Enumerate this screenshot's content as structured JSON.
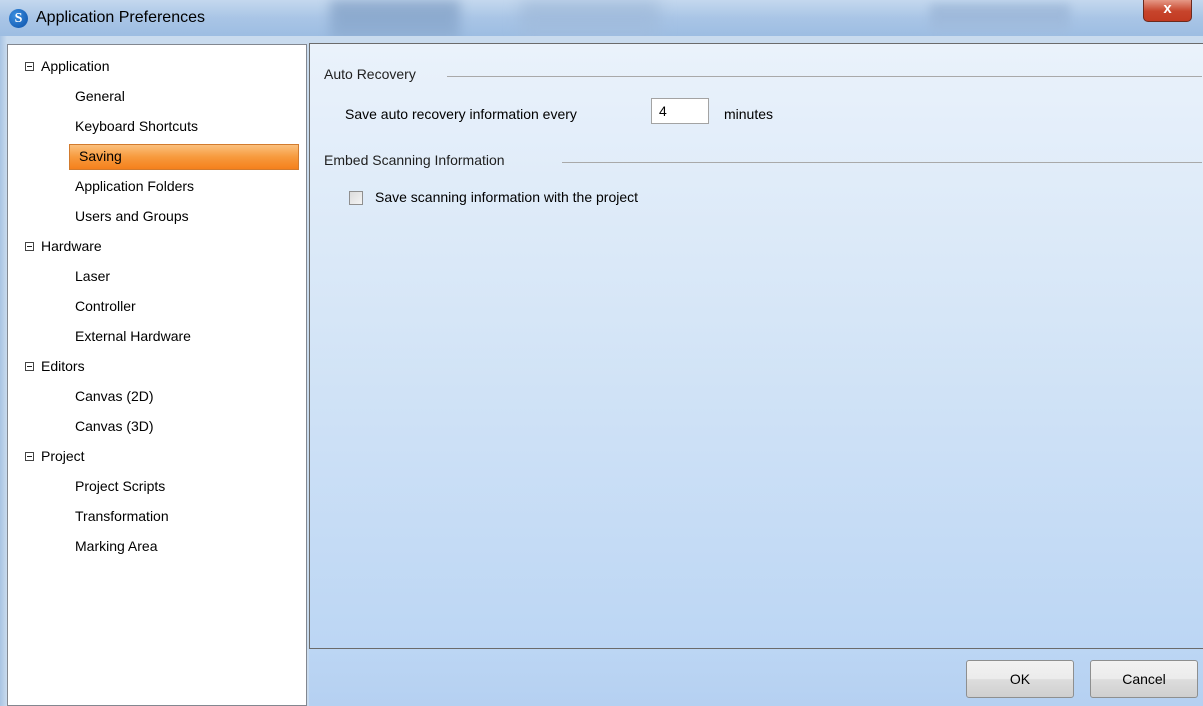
{
  "window": {
    "title": "Application Preferences",
    "icon": "app-logo-icon",
    "close_label": "x"
  },
  "nav": {
    "groups": [
      {
        "label": "Application",
        "items": [
          "General",
          "Keyboard Shortcuts",
          "Saving",
          "Application Folders",
          "Users and Groups"
        ]
      },
      {
        "label": "Hardware",
        "items": [
          "Laser",
          "Controller",
          "External Hardware"
        ]
      },
      {
        "label": "Editors",
        "items": [
          "Canvas (2D)",
          "Canvas (3D)"
        ]
      },
      {
        "label": "Project",
        "items": [
          "Project Scripts",
          "Transformation",
          "Marking Area"
        ]
      }
    ],
    "selected": "Saving"
  },
  "content": {
    "auto_recovery": {
      "title": "Auto Recovery",
      "label_before": "Save auto recovery information every",
      "value": "4",
      "label_after": "minutes"
    },
    "embed_scanning": {
      "title": "Embed Scanning Information",
      "checkbox_label": "Save scanning information with the project",
      "checked": false
    }
  },
  "buttons": {
    "ok": "OK",
    "cancel": "Cancel"
  },
  "colors": {
    "selection": "#f79a3d",
    "close_button": "#c7452c"
  }
}
